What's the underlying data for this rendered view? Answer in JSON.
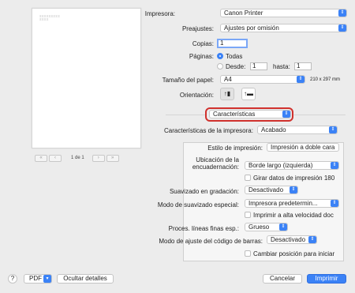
{
  "preview": {
    "text_lines": [
      "ΞΞΞΞΞΞΞΞΞ",
      "ΞΞΞΞ"
    ],
    "page_info": "1 de 1",
    "first_icon": "double-chevron-left-icon",
    "prev_icon": "chevron-left-icon",
    "next_icon": "chevron-right-icon",
    "last_icon": "double-chevron-right-icon"
  },
  "printer": {
    "label": "Impresora:",
    "value": "Canon Printer"
  },
  "presets": {
    "label": "Preajustes:",
    "value": "Ajustes por omisión"
  },
  "copies": {
    "label": "Copias:",
    "value": "1"
  },
  "pages": {
    "label": "Páginas:",
    "all_label": "Todas",
    "from_label": "Desde:",
    "from_value": "1",
    "to_label": "hasta:",
    "to_value": "1"
  },
  "paper_size": {
    "label": "Tamaño del papel:",
    "value": "A4",
    "dimensions": "210 x 297 mm"
  },
  "orientation": {
    "label": "Orientación:",
    "portrait_icon": "portrait-orientation-icon",
    "landscape_icon": "landscape-orientation-icon"
  },
  "section_popup": {
    "value": "Características"
  },
  "features": {
    "label": "Características de la impresora:",
    "value": "Acabado"
  },
  "panel": {
    "print_style": {
      "label": "Estilo de impresión:",
      "value": "Impresión a doble cara"
    },
    "binding": {
      "label_1": "Ubicación de la",
      "label_2": "encuadernación:",
      "value": "Borde largo (izquierda)"
    },
    "rotate_label": "Girar datos de impresión 180",
    "smoothing": {
      "label": "Suavizado en gradación:",
      "value": "Desactivado"
    },
    "smoothing_mode": {
      "label": "Modo de suavizado especial:",
      "value": "Impresora predetermin..."
    },
    "high_speed_label": "Imprimir a alta velocidad doc",
    "fine_lines": {
      "label": "Proces. líneas finas esp.:",
      "value": "Grueso"
    },
    "barcode": {
      "label": "Modo de ajuste del código de barras:",
      "value": "Desactivado"
    },
    "reposition_label": "Cambiar posición para iniciar"
  },
  "footer": {
    "help_label": "?",
    "pdf_label": "PDF",
    "hide_details_label": "Ocultar detalles",
    "cancel_label": "Cancelar",
    "print_label": "Imprimir"
  },
  "colors": {
    "accent": "#3b82f6",
    "highlight_ring": "#d0312d"
  }
}
